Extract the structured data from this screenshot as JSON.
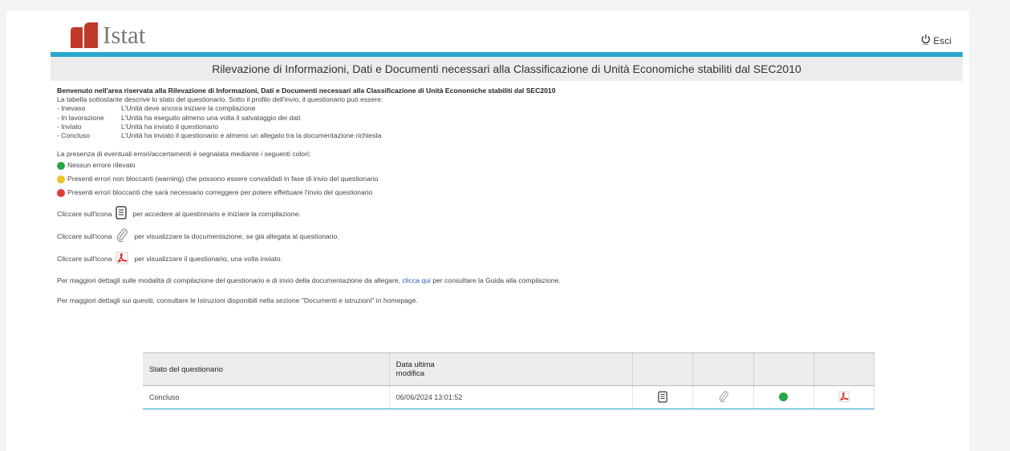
{
  "header": {
    "logo_text": "Istat",
    "logout_label": "Esci",
    "logout_icon": "power-icon"
  },
  "title": "Rilevazione di Informazioni, Dati e Documenti necessari alla Classificazione di Unità Economiche stabiliti dal SEC2010",
  "intro": {
    "welcome": "Benvenuto nell'area riservata alla Rilevazione di Informazioni, Dati e Documenti necessari alla Classificazione di Unità Economiche stabiliti dal SEC2010",
    "description": "La tabella sottostante descrive lo stato del questionario. Sotto il profilo dell'invio, il questionario può essere:",
    "statuses": [
      {
        "name": "- Inevaso",
        "desc": "L'Unità deve ancora iniziare la compilazione"
      },
      {
        "name": "- In lavorazione",
        "desc": "L'Unità ha eseguito almeno una volta il salvataggio dei dati"
      },
      {
        "name": "- Inviato",
        "desc": "L'Unità ha inviato il questionario"
      },
      {
        "name": "- Concluso",
        "desc": "L'Unità ha inviato il questionario e almeno un allegato tra la documentazione richiesta"
      }
    ]
  },
  "colors_intro": "La presenza di eventuali errori/accertamenti è segnalata mediante i seguenti colori:",
  "legend": [
    {
      "color": "#27a745",
      "text": "Nessun errore rilevato"
    },
    {
      "color": "#e8c42a",
      "text": "Presenti errori non bloccanti (warning) che possono essere convalidati in fase di invio del questionario"
    },
    {
      "color": "#e23a3a",
      "text": "Presenti errori bloccanti che sarà necessario correggere per potere effettuare l'invio del questionario"
    }
  ],
  "icon_help": [
    {
      "prefix": "Cliccare sull'icona",
      "icon": "document-icon",
      "suffix": "per accedere al questionario e iniziare la compilazione."
    },
    {
      "prefix": "Cliccare sull'icona",
      "icon": "paperclip-icon",
      "suffix": "per visualizzare la documentazione, se già allegata al questionario."
    },
    {
      "prefix": "Cliccare sull'icona",
      "icon": "pdf-icon",
      "suffix": "per visualizzare il questionario, una volta inviato."
    }
  ],
  "guide": {
    "before": "Per maggiori dettagli sulle modalità di compilazione del questionario e di invio della documentazione da allegare,",
    "link": "clicca qui",
    "after": "per consultare la Guida alla compilazione."
  },
  "instructions": "Per maggiori dettagli sui quesiti, consultare le Istruzioni disponibili nella sezione \"Documenti e istruzioni\" in homepage.",
  "table": {
    "headers": [
      "Stato del questionario",
      "Data ultima modifica",
      "",
      "",
      "",
      ""
    ],
    "rows": [
      {
        "stato": "Concluso",
        "data": "06/06/2024 13:01:52",
        "status_color": "#27a745"
      }
    ]
  },
  "accent_color": "#2aa8cf"
}
